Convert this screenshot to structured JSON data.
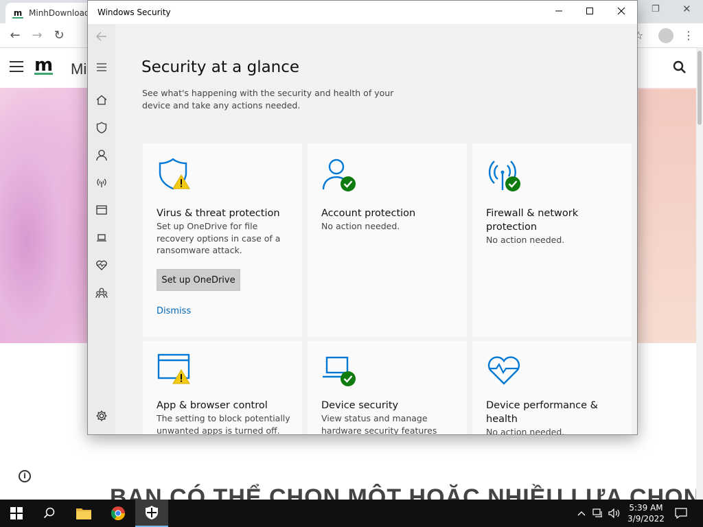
{
  "browser": {
    "tab_title": "MinhDownload",
    "favicon_letter": "m",
    "site_logo": "m",
    "site_name": "Minh",
    "headline": "BẠN CÓ THỂ CHỌN MỘT HOẶC NHIỀU LỰA CHỌN"
  },
  "window": {
    "title": "Windows Security",
    "minimize": "—",
    "maximize": "☐",
    "close": "✕"
  },
  "sidebar": {
    "items": [
      "back",
      "menu",
      "home",
      "virus-protection",
      "account-protection",
      "firewall",
      "app-browser-control",
      "device-security",
      "device-performance",
      "family-options",
      "settings"
    ]
  },
  "main": {
    "title": "Security at a glance",
    "subtitle": "See what's happening with the security and health of your device and take any actions needed.",
    "cards": [
      {
        "title": "Virus & threat protection",
        "description": "Set up OneDrive for file recovery options in case of a ransomware attack.",
        "button": "Set up OneDrive",
        "link": "Dismiss",
        "status": "warning"
      },
      {
        "title": "Account protection",
        "description": "No action needed.",
        "status": "ok"
      },
      {
        "title": "Firewall & network protection",
        "description": "No action needed.",
        "status": "ok"
      },
      {
        "title": "App & browser control",
        "description": "The setting to block potentially unwanted apps is turned off.",
        "status": "warning"
      },
      {
        "title": "Device security",
        "description": "View status and manage hardware security features",
        "status": "ok"
      },
      {
        "title": "Device performance & health",
        "description": "No action needed.",
        "status": "ok"
      }
    ]
  },
  "taskbar": {
    "time": "5:39 AM",
    "date": "3/9/2022"
  },
  "colors": {
    "accent": "#0067b8",
    "icon_blue": "#0078d4",
    "ok_green": "#107c10",
    "warning_yellow": "#f2c811"
  }
}
